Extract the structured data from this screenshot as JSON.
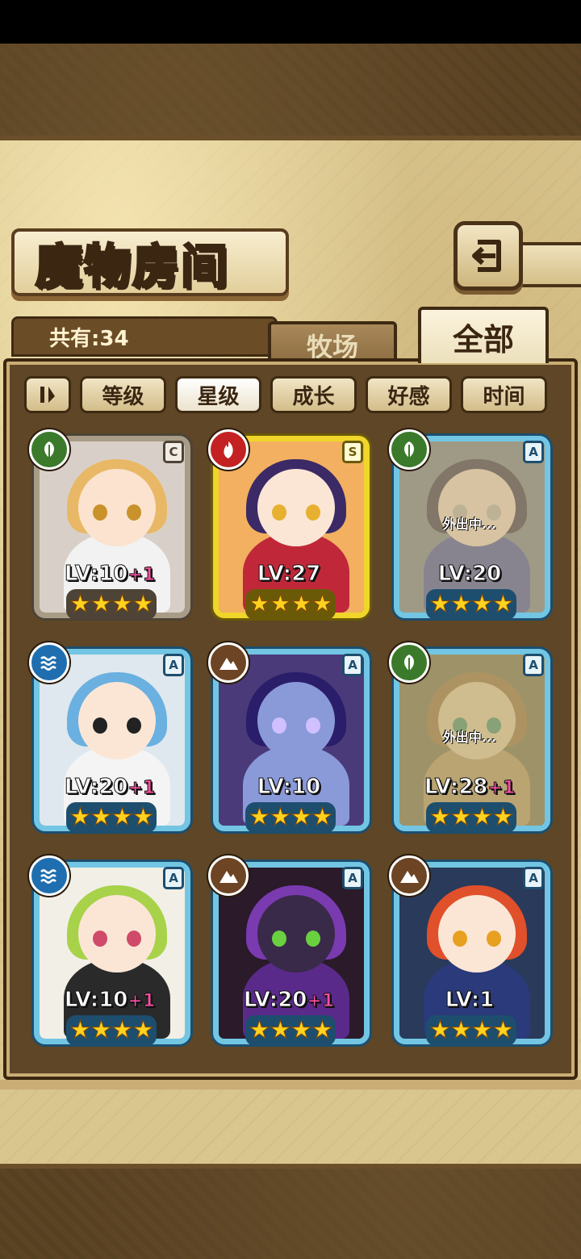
{
  "header": {
    "title": "魔物房间",
    "back_icon": "return-arrow-icon"
  },
  "summary": {
    "count_label": "共有:34"
  },
  "tabs": [
    {
      "label": "牧场",
      "selected": false
    },
    {
      "label": "全部",
      "selected": true
    }
  ],
  "sort": {
    "toggle_icon": "sort-order-icon",
    "options": [
      {
        "label": "等级",
        "active": false
      },
      {
        "label": "星级",
        "active": true
      },
      {
        "label": "成长",
        "active": false
      },
      {
        "label": "好感",
        "active": false
      },
      {
        "label": "时间",
        "active": false
      }
    ]
  },
  "monsters": [
    {
      "level": "LV:10",
      "bonus": "+1",
      "rank": "C",
      "element": "grass",
      "stars": 4,
      "away": "",
      "frame": "bronze",
      "palette": {
        "hair": "#e9b866",
        "skin": "#fbe3cf",
        "body": "#f2f2f2",
        "eye": "#c9922a",
        "bg": "#d8d0c8"
      }
    },
    {
      "level": "LV:27",
      "bonus": "",
      "rank": "S",
      "element": "fire",
      "stars": 4,
      "away": "",
      "frame": "gold",
      "palette": {
        "hair": "#3b2a66",
        "skin": "#fbe6d6",
        "body": "#c0283a",
        "eye": "#e8b030",
        "bg": "#f2b060"
      }
    },
    {
      "level": "LV:20",
      "bonus": "",
      "rank": "A",
      "element": "grass",
      "stars": 4,
      "away": "外出中...",
      "frame": "blue",
      "palette": {
        "hair": "#2a2a4a",
        "skin": "#e8d6c8",
        "body": "#3a4aa0",
        "eye": "#b0b0b0",
        "bg": "#6a7a8a"
      }
    },
    {
      "level": "LV:20",
      "bonus": "+1",
      "rank": "A",
      "element": "water",
      "stars": 4,
      "away": "",
      "frame": "blue",
      "palette": {
        "hair": "#6ab0e0",
        "skin": "#fbe6d6",
        "body": "#f4f4f4",
        "eye": "#222222",
        "bg": "#dfe8ee"
      }
    },
    {
      "level": "LV:10",
      "bonus": "",
      "rank": "A",
      "element": "earth",
      "stars": 4,
      "away": "",
      "frame": "blue",
      "palette": {
        "hair": "#2a1e6a",
        "skin": "#8a9ad8",
        "body": "#8a9ad8",
        "eye": "#d0c0ff",
        "bg": "#4a3a7a"
      }
    },
    {
      "level": "LV:28",
      "bonus": "+1",
      "rank": "A",
      "element": "grass",
      "stars": 4,
      "away": "外出中...",
      "frame": "blue",
      "palette": {
        "hair": "#8a6a3a",
        "skin": "#d8c8a0",
        "body": "#a89060",
        "eye": "#3a8a6a",
        "bg": "#6a6a4a"
      }
    },
    {
      "level": "LV:10",
      "bonus": "+1",
      "rank": "A",
      "element": "water",
      "stars": 4,
      "away": "",
      "frame": "blue",
      "palette": {
        "hair": "#a8d24a",
        "skin": "#fbe6d6",
        "body": "#2a2a2a",
        "eye": "#d04a6a",
        "bg": "#f2efe6"
      }
    },
    {
      "level": "LV:20",
      "bonus": "+1",
      "rank": "A",
      "element": "earth",
      "stars": 4,
      "away": "",
      "frame": "blue",
      "palette": {
        "hair": "#7a3ab0",
        "skin": "#3a2a4a",
        "body": "#5a2a8a",
        "eye": "#6ad040",
        "bg": "#2a1a2a"
      }
    },
    {
      "level": "LV:1",
      "bonus": "",
      "rank": "A",
      "element": "earth",
      "stars": 4,
      "away": "",
      "frame": "blue",
      "palette": {
        "hair": "#e0502a",
        "skin": "#fbe6d6",
        "body": "#2a3a7a",
        "eye": "#e8a020",
        "bg": "#2a3a5a"
      }
    }
  ]
}
